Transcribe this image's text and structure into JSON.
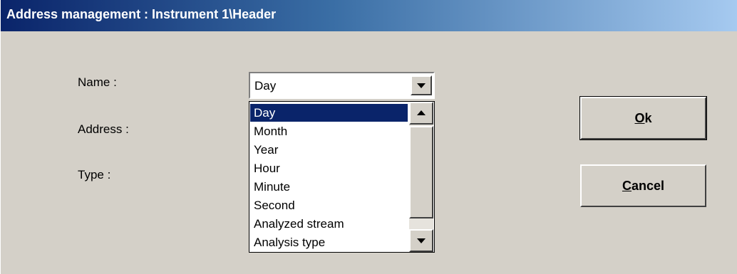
{
  "window": {
    "title": "Address management : Instrument 1\\Header"
  },
  "form": {
    "name_label": "Name :",
    "address_label": "Address :",
    "type_label": "Type :"
  },
  "name_combo": {
    "selected_value": "Day",
    "options": [
      "Day",
      "Month",
      "Year",
      "Hour",
      "Minute",
      "Second",
      "Analyzed stream",
      "Analysis type"
    ],
    "highlighted_option": "Day"
  },
  "buttons": {
    "ok_label": "Ok",
    "cancel_label": "Cancel"
  },
  "icons": {
    "dropdown": "chevron-down-icon",
    "scroll_up": "scroll-up-icon",
    "scroll_down": "scroll-down-icon"
  },
  "colors": {
    "dialog_bg": "#d4d0c8",
    "title_gradient_start": "#0a246a",
    "title_gradient_end": "#a6caf0",
    "selection_bg": "#0a246a"
  }
}
